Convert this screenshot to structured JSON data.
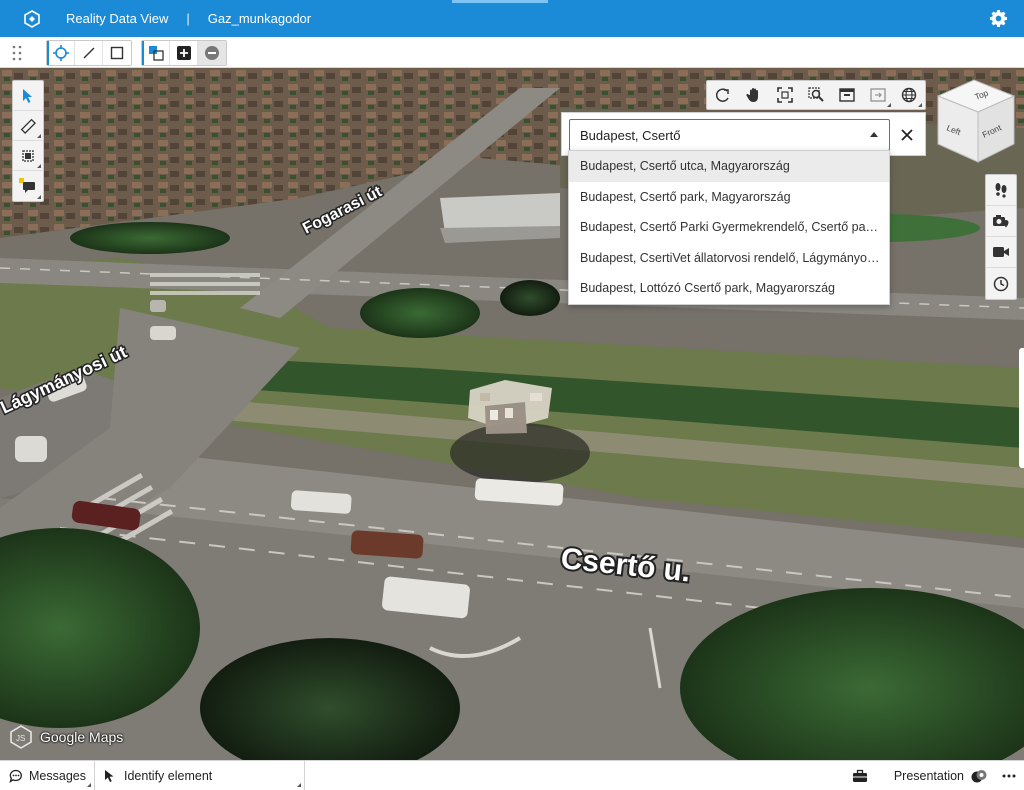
{
  "app": {
    "title": "Reality Data View",
    "separator": "|",
    "project": "Gaz_munkagodor",
    "accent_color": "#1b8ad7"
  },
  "toolbar": {
    "buttons": [
      {
        "icon": "select-point-icon",
        "active": true
      },
      {
        "icon": "line-icon"
      },
      {
        "icon": "rectangle-icon"
      },
      {
        "icon": "selection-set-icon"
      },
      {
        "icon": "add-icon"
      },
      {
        "icon": "remove-icon",
        "disabled": true
      }
    ]
  },
  "left_tools": [
    {
      "icon": "cursor-icon"
    },
    {
      "icon": "measure-icon"
    },
    {
      "icon": "clip-section-icon"
    },
    {
      "icon": "markup-comment-icon"
    }
  ],
  "view_tools": [
    {
      "icon": "rotate-icon"
    },
    {
      "icon": "pan-hand-icon"
    },
    {
      "icon": "fit-view-icon"
    },
    {
      "icon": "zoom-window-icon"
    },
    {
      "icon": "window-area-icon"
    },
    {
      "icon": "saved-views-icon"
    },
    {
      "icon": "globe-icon"
    }
  ],
  "search": {
    "value": "Budapest, Csertő",
    "results": [
      "Budapest, Csertő utca, Magyarország",
      "Budapest, Csertő park, Magyarország",
      "Budapest, Csertő Parki Gyermekrendelő, Csertő park, Magyarország",
      "Budapest, CsertiVet állatorvosi rendelő, Lágymányosi út, Magyarország",
      "Budapest, Lottózó Csertő park, Magyarország"
    ]
  },
  "nav_cube": {
    "top": "Top",
    "left": "Left",
    "front": "Front"
  },
  "right_tools": [
    {
      "icon": "walk-icon"
    },
    {
      "icon": "camera-location-icon"
    },
    {
      "icon": "video-camera-icon"
    },
    {
      "icon": "clock-icon"
    }
  ],
  "map": {
    "labels": {
      "street1": "Fogarasi út",
      "street2": "Csertő u.",
      "street3": "Lágymányosi út"
    },
    "attribution": "Google Maps"
  },
  "status": {
    "messages": "Messages",
    "identify": "Identify element",
    "presentation": "Presentation"
  }
}
